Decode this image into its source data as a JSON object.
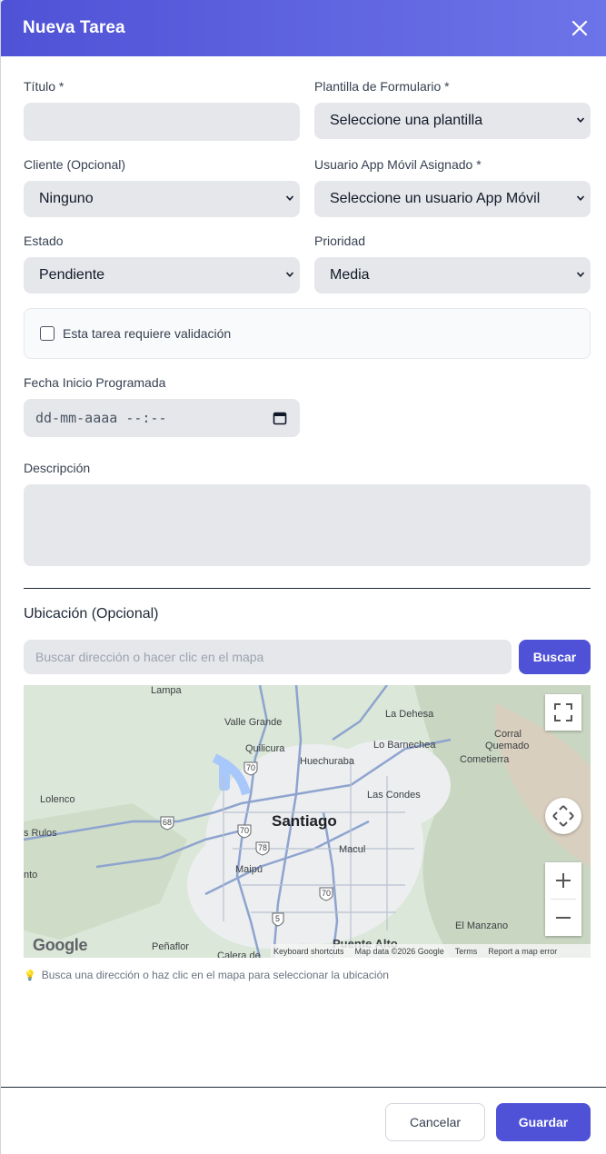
{
  "header": {
    "title": "Nueva Tarea"
  },
  "form": {
    "titulo_label": "Título *",
    "titulo_value": "",
    "plantilla_label": "Plantilla de Formulario *",
    "plantilla_value": "Seleccione una plantilla",
    "cliente_label": "Cliente (Opcional)",
    "cliente_value": "Ninguno",
    "usuario_label": "Usuario App Móvil Asignado *",
    "usuario_value": "Seleccione un usuario App Móvil",
    "estado_label": "Estado",
    "estado_value": "Pendiente",
    "prioridad_label": "Prioridad",
    "prioridad_value": "Media",
    "validacion_label": "Esta tarea requiere validación",
    "validacion_checked": false,
    "fecha_label": "Fecha Inicio Programada",
    "fecha_placeholder": "dd-mm-aaaa --:--",
    "descripcion_label": "Descripción",
    "descripcion_value": ""
  },
  "location": {
    "title": "Ubicación (Opcional)",
    "search_placeholder": "Buscar dirección o hacer clic en el mapa",
    "search_button": "Buscar",
    "hint": "Busca una dirección o haz clic en el mapa para seleccionar la ubicación"
  },
  "map": {
    "city": "Santiago",
    "places": {
      "lampa": "Lampa",
      "la_dehesa": "La Dehesa",
      "valle_grande": "Valle Grande",
      "corral": "Corral",
      "quemado": "Quemado",
      "quilicura": "Quilicura",
      "lo_barnechea": "Lo Barnechea",
      "huechuraba": "Huechuraba",
      "cometierra": "Cometierra",
      "lolenco": "Lolenco",
      "las_condes": "Las Condes",
      "rulos": "s Rulos",
      "macul": "Macul",
      "maipu": "Maipú",
      "nto": "nto",
      "el_manzano": "El Manzano",
      "penaflor": "Peñaflor",
      "calera": "Calera de",
      "puente_alto": "Puente Alto"
    },
    "route_badges": [
      "70",
      "68",
      "70",
      "78",
      "70",
      "5"
    ],
    "google": "Google",
    "attribution": {
      "shortcuts": "Keyboard shortcuts",
      "data": "Map data ©2026 Google",
      "terms": "Terms",
      "report": "Report a map error"
    },
    "accent": "#4f52d6"
  },
  "footer": {
    "cancel": "Cancelar",
    "save": "Guardar"
  }
}
